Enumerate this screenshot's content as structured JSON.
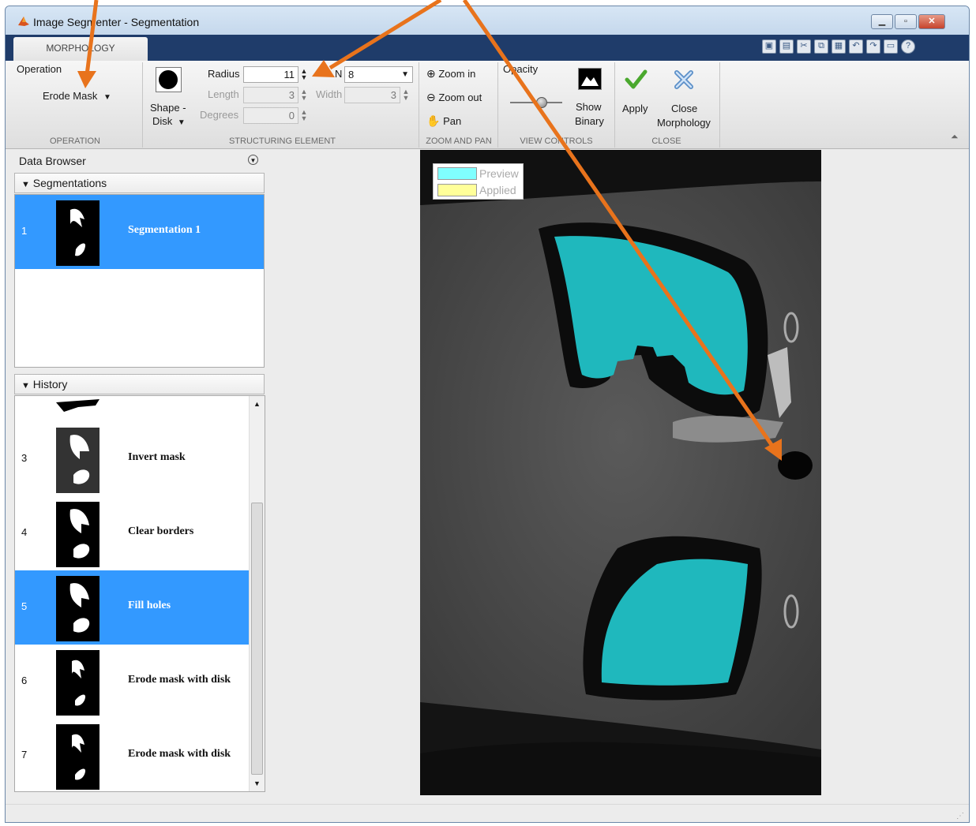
{
  "window": {
    "title": "Image Segmenter - Segmentation",
    "controls": [
      "minimize",
      "maximize",
      "close"
    ]
  },
  "tabs": [
    {
      "label": "MORPHOLOGY",
      "active": true
    }
  ],
  "quick_access_icons": [
    "new-icon",
    "save-icon",
    "cut-icon",
    "copy-icon",
    "paste-icon",
    "undo-icon",
    "redo-icon",
    "layout-icon",
    "help-icon"
  ],
  "toolstrip": {
    "operation": {
      "section_label": "OPERATION",
      "label": "Operation",
      "selected": "Erode Mask"
    },
    "structuring_element": {
      "section_label": "STRUCTURING ELEMENT",
      "shape_label": "Shape -",
      "shape_value": "Disk",
      "radius_label": "Radius",
      "radius_value": "11",
      "n_label": "N",
      "n_value": "8",
      "length_label": "Length",
      "length_value": "3",
      "width_label": "Width",
      "width_value": "3",
      "degrees_label": "Degrees",
      "degrees_value": "0"
    },
    "zoom_pan": {
      "section_label": "ZOOM AND PAN",
      "zoom_in": "Zoom in",
      "zoom_out": "Zoom out",
      "pan": "Pan"
    },
    "view_controls": {
      "section_label": "VIEW CONTROLS",
      "opacity_label": "Opacity",
      "opacity_level": 0.6,
      "show_binary_line1": "Show",
      "show_binary_line2": "Binary"
    },
    "close": {
      "section_label": "CLOSE",
      "apply": "Apply",
      "close_line1": "Close",
      "close_line2": "Morphology"
    }
  },
  "data_browser": {
    "title": "Data Browser",
    "segmentations": {
      "header": "Segmentations",
      "items": [
        {
          "num": "1",
          "label": "Segmentation 1",
          "selected": true
        }
      ]
    },
    "history": {
      "header": "History",
      "items": [
        {
          "num": "3",
          "label": "Invert mask",
          "selected": false
        },
        {
          "num": "4",
          "label": "Clear borders",
          "selected": false
        },
        {
          "num": "5",
          "label": "Fill holes",
          "selected": true
        },
        {
          "num": "6",
          "label": "Erode mask with disk",
          "selected": false
        },
        {
          "num": "7",
          "label": "Erode mask with disk",
          "selected": false
        }
      ]
    }
  },
  "image_legend": {
    "preview_label": "Preview",
    "applied_label": "Applied",
    "preview_color": "#80ffff",
    "applied_color": "#ffff99"
  },
  "colors": {
    "selection": "#3399ff",
    "annotation_arrow": "#e8731c",
    "mask_overlay": "#1fb8bd"
  }
}
